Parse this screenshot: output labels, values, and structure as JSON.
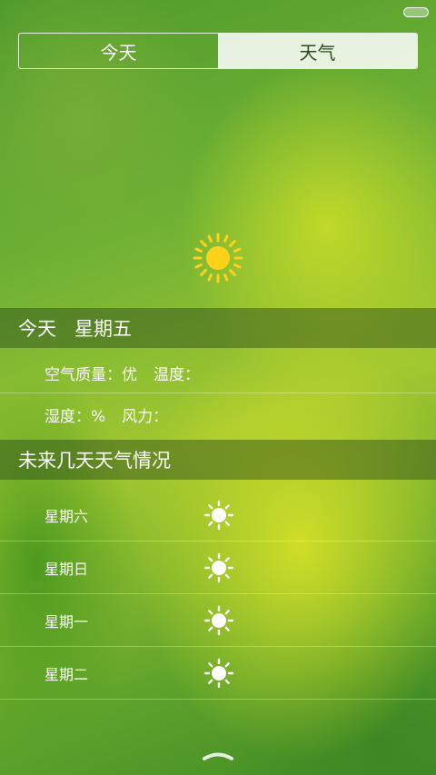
{
  "tabs": {
    "today": "今天",
    "weather": "天气"
  },
  "today": {
    "label": "今天",
    "weekday": "星期五"
  },
  "details": {
    "air_quality": "空气质量：优",
    "temperature": "温度：",
    "humidity": "湿度：%",
    "wind": "风力："
  },
  "forecast": {
    "title": "未来几天天气情况",
    "days": [
      {
        "label": "星期六",
        "icon": "sun-icon"
      },
      {
        "label": "星期日",
        "icon": "sun-icon"
      },
      {
        "label": "星期一",
        "icon": "sun-icon"
      },
      {
        "label": "星期二",
        "icon": "sun-icon"
      }
    ]
  },
  "colors": {
    "sun_fill": "#ffd21a",
    "band": "#28461a"
  }
}
